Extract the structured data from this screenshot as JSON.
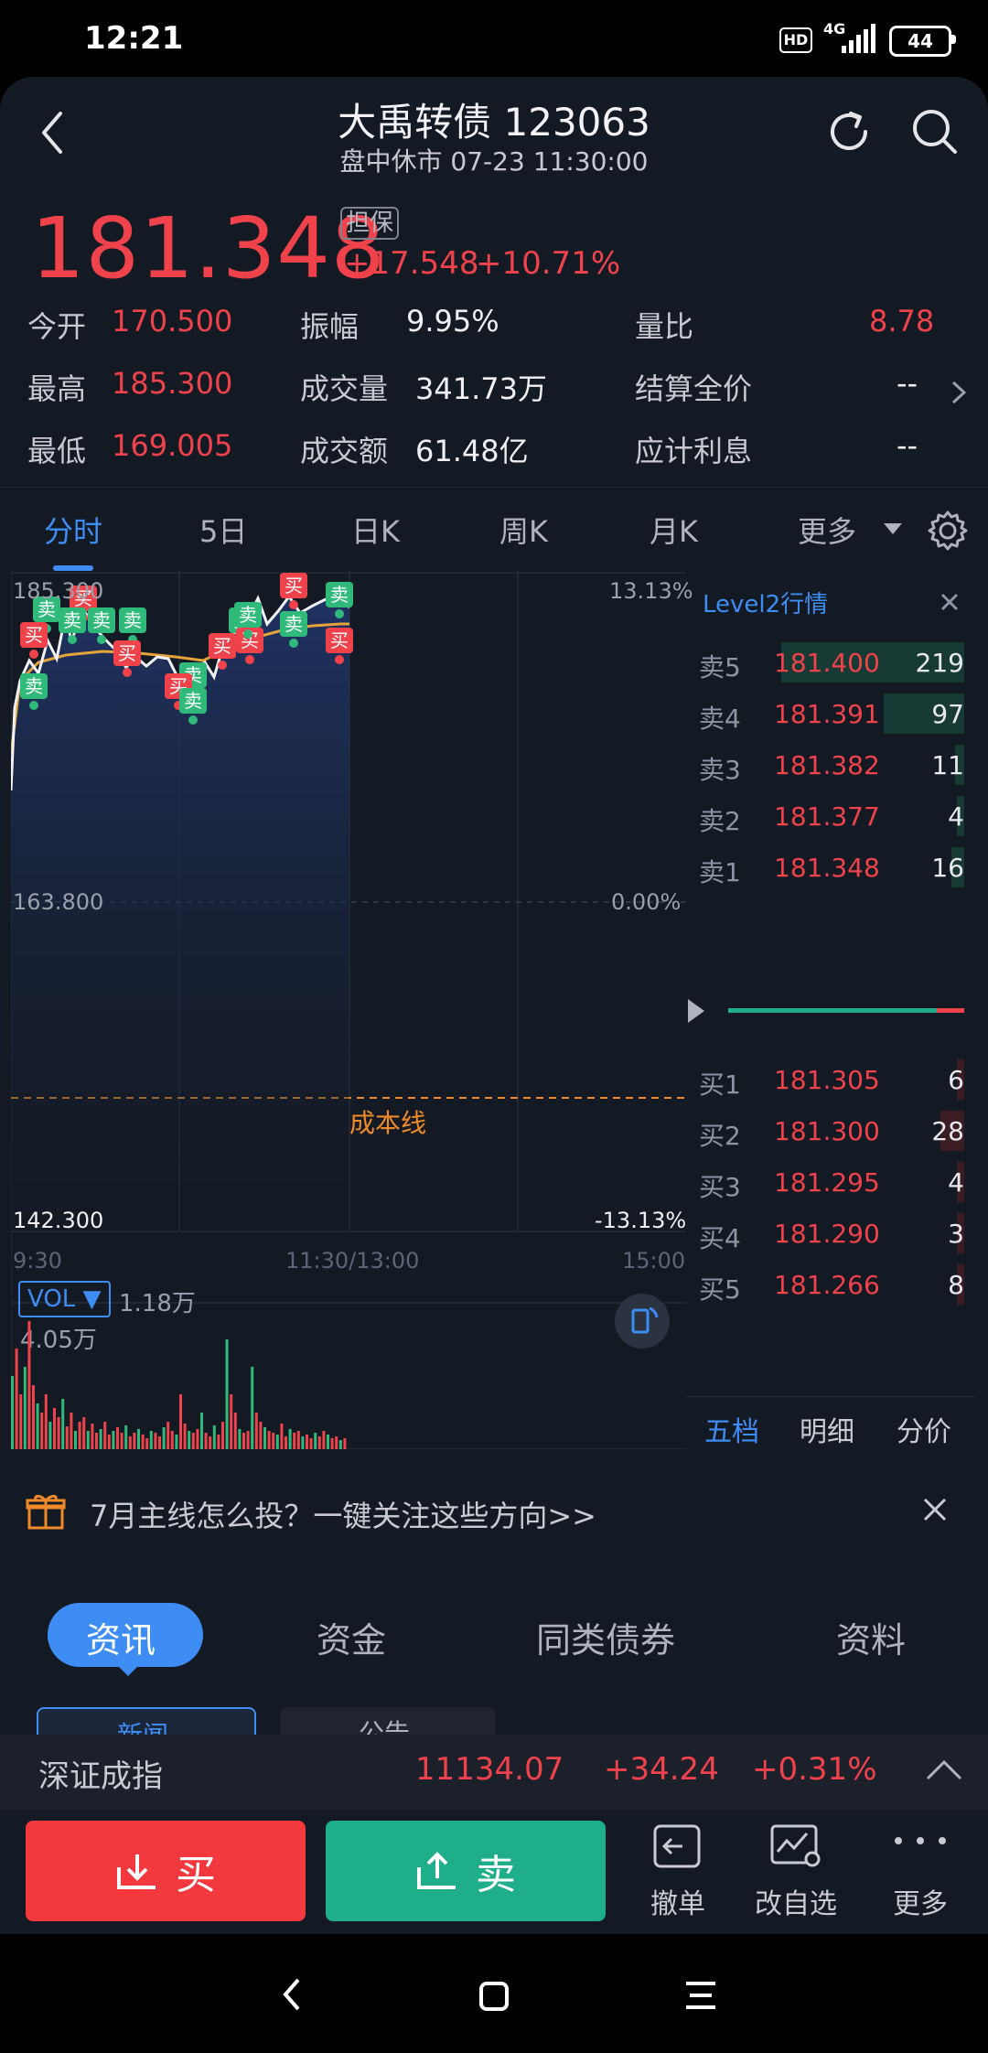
{
  "status_bar": {
    "time": "12:21",
    "hd": "HD",
    "network": "4G",
    "battery": "44"
  },
  "header": {
    "title": "大禹转债 123063",
    "subtitle": "盘中休市 07-23 11:30:00"
  },
  "quote": {
    "price": "181.348",
    "tag": "担保",
    "change": "+17.548",
    "change_pct": "+10.71%"
  },
  "stats": {
    "open_label": "今开",
    "open": "170.500",
    "high_label": "最高",
    "high": "185.300",
    "low_label": "最低",
    "low": "169.005",
    "amplitude_label": "振幅",
    "amplitude": "9.95%",
    "volume_label": "成交量",
    "volume": "341.73万",
    "turnover_label": "成交额",
    "turnover": "61.48亿",
    "vol_ratio_label": "量比",
    "vol_ratio": "8.78",
    "settle_label": "结算全价",
    "settle": "--",
    "interest_label": "应计利息",
    "interest": "--"
  },
  "chart_tabs": [
    "分时",
    "5日",
    "日K",
    "周K",
    "月K",
    "更多"
  ],
  "chart": {
    "y_top_left": "185.300",
    "y_mid_left": "163.800",
    "y_bot_left": "142.300",
    "y_top_right": "13.13%",
    "y_mid_right": "0.00%",
    "y_bot_right": "-13.13%",
    "x_start": "9:30",
    "x_mid": "11:30/13:00",
    "x_end": "15:00",
    "cost_line_label": "成本线",
    "vol_label": "VOL",
    "vol_value": "1.18万",
    "vol_max": "4.05万",
    "buy_marker": "买",
    "sell_marker": "卖"
  },
  "level2": {
    "title": "Level2行情",
    "asks": [
      {
        "label": "卖5",
        "price": "181.400",
        "vol": "219",
        "bar": 1.0
      },
      {
        "label": "卖4",
        "price": "181.391",
        "vol": "97",
        "bar": 0.44
      },
      {
        "label": "卖3",
        "price": "181.382",
        "vol": "11",
        "bar": 0.05
      },
      {
        "label": "卖2",
        "price": "181.377",
        "vol": "4",
        "bar": 0.02
      },
      {
        "label": "卖1",
        "price": "181.348",
        "vol": "16",
        "bar": 0.07
      }
    ],
    "bids": [
      {
        "label": "买1",
        "price": "181.305",
        "vol": "6",
        "bar": 0.03
      },
      {
        "label": "买2",
        "price": "181.300",
        "vol": "28",
        "bar": 0.13
      },
      {
        "label": "买3",
        "price": "181.295",
        "vol": "4",
        "bar": 0.02
      },
      {
        "label": "买4",
        "price": "181.290",
        "vol": "3",
        "bar": 0.015
      },
      {
        "label": "买5",
        "price": "181.266",
        "vol": "8",
        "bar": 0.04
      }
    ],
    "tabs": [
      "五档",
      "明细",
      "分价"
    ]
  },
  "promo": {
    "text": "7月主线怎么投？一键关注这些方向>>"
  },
  "news_tabs": [
    "资讯",
    "资金",
    "同类债券",
    "资料"
  ],
  "news_subtabs": [
    "新闻",
    "公告"
  ],
  "index": {
    "name": "深证成指",
    "value": "11134.07",
    "change": "+34.24",
    "pct": "+0.31%"
  },
  "actions": {
    "buy": "买",
    "sell": "卖",
    "cancel": "撤单",
    "watchlist": "改自选",
    "more": "更多"
  }
}
